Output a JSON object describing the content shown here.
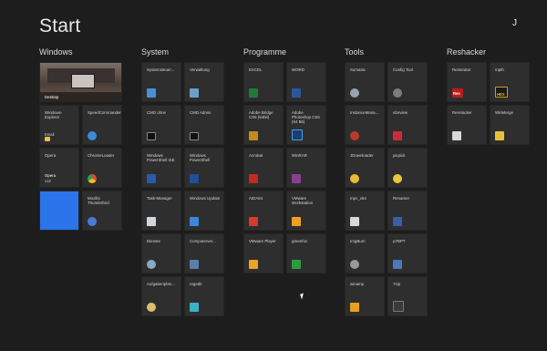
{
  "header": {
    "title": "Start",
    "user": "J"
  },
  "groups": [
    {
      "label": "Windows",
      "tiles": [
        {
          "label": "Desktop",
          "wide": true,
          "kind": "desktop"
        },
        {
          "label": "Windows-Explorer",
          "badge": "Email",
          "icon": "folder-icon",
          "color": "#e7c24a"
        },
        {
          "label": "SpeedCommander",
          "icon": "speedcommander-icon",
          "color": "#3a8ad8"
        },
        {
          "label": "Opera",
          "badge": "Opera",
          "badge2": "v12",
          "icon": "opera-icon",
          "color": "#c8102e"
        },
        {
          "label": "ChromeLoader",
          "icon": "chrome-icon",
          "color": "#dd4b39"
        },
        {
          "label": "",
          "kind": "thunderbird"
        },
        {
          "label": "Mozilla Thunderbird",
          "icon": "thunderbird-icon",
          "color": "#4a7bd3"
        }
      ]
    },
    {
      "label": "System",
      "tiles": [
        {
          "label": "Systemsteuer...",
          "icon": "control-panel-icon",
          "color": "#4a8fd4"
        },
        {
          "label": "Verwaltung",
          "icon": "admin-tools-icon",
          "color": "#6aa0c8"
        },
        {
          "label": "CMD ohne",
          "icon": "cmd-icon",
          "color": "#111111"
        },
        {
          "label": "CMD Admin",
          "icon": "cmd-admin-icon",
          "color": "#111111"
        },
        {
          "label": "Windows PowerShell ISE",
          "icon": "powershell-ise-icon",
          "color": "#2a5aa8"
        },
        {
          "label": "Windows PowerShell",
          "icon": "powershell-icon",
          "color": "#1f4f98"
        },
        {
          "label": "Task-Manager",
          "icon": "task-manager-icon",
          "color": "#7ab648"
        },
        {
          "label": "Windows Update",
          "icon": "windows-update-icon",
          "color": "#3d87d8"
        },
        {
          "label": "Dienste",
          "icon": "services-icon",
          "color": "#8aa7c4"
        },
        {
          "label": "Computerver...",
          "icon": "computer-management-icon",
          "color": "#5a7fa8"
        },
        {
          "label": "Aufgabenplan...",
          "icon": "task-scheduler-icon",
          "color": "#d8c070"
        },
        {
          "label": "regedit",
          "icon": "regedit-icon",
          "color": "#3bb1c8"
        }
      ]
    },
    {
      "label": "Programme",
      "tiles": [
        {
          "label": "EXCEL",
          "icon": "excel-icon",
          "color": "#1f7a3a"
        },
        {
          "label": "WORD",
          "icon": "word-icon",
          "color": "#2b579a"
        },
        {
          "label": "Adobe Bridge CS6 (64bit)",
          "icon": "bridge-icon",
          "color": "#c48a1e"
        },
        {
          "label": "Adobe Photoshop CS6 (64 Bit)",
          "icon": "photoshop-icon",
          "color": "#1c3e70"
        },
        {
          "label": "Acrobat",
          "icon": "acrobat-icon",
          "color": "#c5281c"
        },
        {
          "label": "WinRAR",
          "icon": "winrar-icon",
          "color": "#8a3f8f"
        },
        {
          "label": "AIDA64",
          "icon": "aida64-icon",
          "color": "#d83a2a"
        },
        {
          "label": "VMware Workstation",
          "icon": "vmware-workstation-icon",
          "color": "#f0a020"
        },
        {
          "label": "VMware Player",
          "icon": "vmware-player-icon",
          "color": "#e8a42a"
        },
        {
          "label": "greenfox",
          "icon": "greenfox-icon",
          "color": "#2f9b3c"
        }
      ]
    },
    {
      "label": "Tools",
      "tiles": [
        {
          "label": "Sumatra",
          "icon": "sumatra-icon",
          "color": "#9aa4ae"
        },
        {
          "label": "Config Tool",
          "icon": "config-tool-icon",
          "color": "#7d7d7d"
        },
        {
          "label": "InstanceMana...",
          "icon": "instance-manager-icon",
          "color": "#b83a2e"
        },
        {
          "label": "xfarview",
          "icon": "xfarview-icon",
          "color": "#cc2a3a"
        },
        {
          "label": "JDownloader",
          "icon": "jdownloader-icon",
          "color": "#e8b93a"
        },
        {
          "label": "picpick",
          "icon": "picpick-icon",
          "color": "#e8c83a"
        },
        {
          "label": "mpc_x64",
          "icon": "mpc-icon",
          "color": "#d8d8d8"
        },
        {
          "label": "Renamer",
          "icon": "renamer-icon",
          "color": "#3b5ea8"
        },
        {
          "label": "ImgBurn",
          "icon": "imgburn-icon",
          "color": "#9a9a9a"
        },
        {
          "label": "p7BPT",
          "icon": "p7bpt-icon",
          "color": "#4a7ab8"
        },
        {
          "label": "winamp",
          "icon": "winamp-icon",
          "color": "#e8a020"
        },
        {
          "label": "7zip",
          "icon": "7zip-icon",
          "color": "#3a3a3a"
        }
      ]
    },
    {
      "label": "Reshacker",
      "tiles": [
        {
          "label": "Restorator",
          "badge": "Res",
          "icon": "restorator-icon",
          "color": "#b81c1c"
        },
        {
          "label": "mpth",
          "badge": "HEX",
          "icon": "hex-editor-icon",
          "color": "#c8a020"
        },
        {
          "label": "ResHacker",
          "icon": "reshacker-icon",
          "color": "#d8d8d8"
        },
        {
          "label": "WinMerge",
          "icon": "winmerge-icon",
          "color": "#e8c040"
        }
      ]
    }
  ]
}
